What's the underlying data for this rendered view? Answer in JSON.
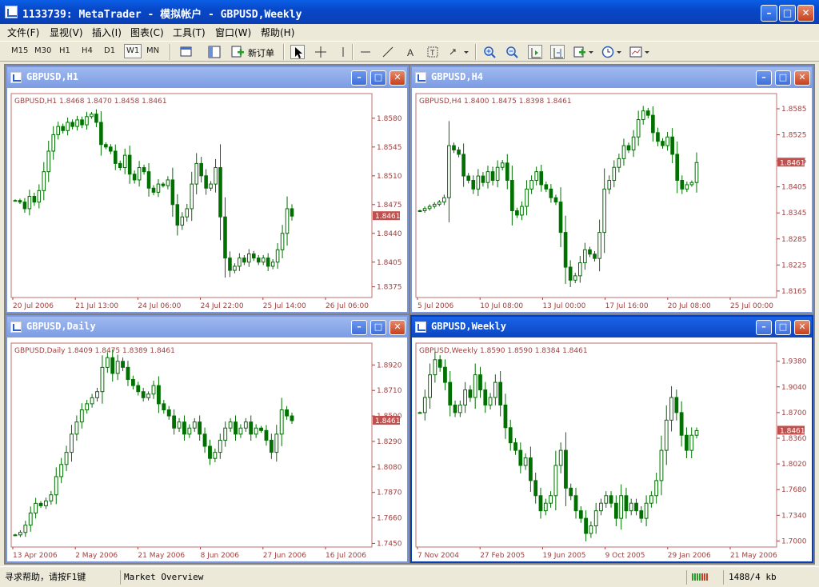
{
  "app": {
    "title": "1133739: MetaTrader - 模拟帐户 - GBPUSD,Weekly"
  },
  "menu": [
    "文件(F)",
    "显视(V)",
    "插入(I)",
    "图表(C)",
    "工具(T)",
    "窗口(W)",
    "帮助(H)"
  ],
  "toolbar": {
    "timeframes": [
      "M15",
      "M30",
      "H1",
      "H4",
      "D1",
      "W1",
      "MN"
    ],
    "active_timeframe": "W1",
    "new_order_label": "新订单"
  },
  "charts": [
    {
      "window_title": "GBPUSD,H1",
      "info": "GBPUSD,H1  1.8468 1.8470 1.8458 1.8461",
      "price_labels": [
        "1.8580",
        "1.8545",
        "1.8510",
        "1.8475",
        "1.8440",
        "1.8405",
        "1.8375"
      ],
      "price_values": [
        1.858,
        1.8545,
        1.851,
        1.8475,
        1.844,
        1.8405,
        1.8375
      ],
      "time_labels": [
        "20 Jul 2006",
        "21 Jul 13:00",
        "24 Jul 06:00",
        "24 Jul 22:00",
        "25 Jul 14:00",
        "26 Jul 06:00"
      ],
      "current_price": "1.8461",
      "ymin": 1.8362,
      "ymax": 1.861,
      "close_path": [
        1.848,
        1.8478,
        1.847,
        1.8485,
        1.8478,
        1.8492,
        1.8515,
        1.854,
        1.856,
        1.857,
        1.8565,
        1.8575,
        1.857,
        1.8578,
        1.8572,
        1.8582,
        1.8585,
        1.8575,
        1.8548,
        1.8545,
        1.854,
        1.8525,
        1.852,
        1.8535,
        1.8512,
        1.8505,
        1.852,
        1.8515,
        1.8495,
        1.849,
        1.85,
        1.8498,
        1.8505,
        1.8475,
        1.845,
        1.846,
        1.847,
        1.85,
        1.8525,
        1.851,
        1.8495,
        1.85,
        1.852,
        1.846,
        1.841,
        1.8395,
        1.84,
        1.841,
        1.8405,
        1.8415,
        1.841,
        1.8405,
        1.841,
        1.84,
        1.8405,
        1.842,
        1.844,
        1.847,
        1.8461
      ]
    },
    {
      "window_title": "GBPUSD,H4",
      "info": "GBPUSD,H4  1.8400 1.8475 1.8398 1.8461",
      "price_labels": [
        "1.8585",
        "1.8525",
        "1.8465",
        "1.8405",
        "1.8345",
        "1.8285",
        "1.8225",
        "1.8165"
      ],
      "price_values": [
        1.8585,
        1.8525,
        1.8465,
        1.8405,
        1.8345,
        1.8285,
        1.8225,
        1.8165
      ],
      "time_labels": [
        "5 Jul 2006",
        "10 Jul 08:00",
        "13 Jul 00:00",
        "17 Jul 16:00",
        "20 Jul 08:00",
        "25 Jul 00:00"
      ],
      "current_price": "1.8461",
      "ymin": 1.815,
      "ymax": 1.862,
      "close_path": [
        1.835,
        1.8355,
        1.836,
        1.8365,
        1.837,
        1.838,
        1.85,
        1.849,
        1.848,
        1.843,
        1.842,
        1.84,
        1.843,
        1.8415,
        1.844,
        1.842,
        1.845,
        1.846,
        1.842,
        1.835,
        1.834,
        1.836,
        1.84,
        1.842,
        1.844,
        1.841,
        1.84,
        1.838,
        1.837,
        1.83,
        1.822,
        1.819,
        1.82,
        1.823,
        1.826,
        1.825,
        1.824,
        1.83,
        1.84,
        1.842,
        1.845,
        1.847,
        1.85,
        1.849,
        1.852,
        1.856,
        1.858,
        1.857,
        1.853,
        1.851,
        1.85,
        1.852,
        1.848,
        1.842,
        1.84,
        1.841,
        1.8415,
        1.8461
      ]
    },
    {
      "window_title": "GBPUSD,Daily",
      "info": "GBPUSD,Daily  1.8409 1.8475 1.8389 1.8461",
      "price_labels": [
        "1.8920",
        "1.8710",
        "1.8500",
        "1.8290",
        "1.8080",
        "1.7870",
        "1.7660",
        "1.7450"
      ],
      "price_values": [
        1.892,
        1.871,
        1.85,
        1.829,
        1.808,
        1.787,
        1.766,
        1.745
      ],
      "time_labels": [
        "13 Apr 2006",
        "2 May 2006",
        "21 May 2006",
        "8 Jun 2006",
        "27 Jun 2006",
        "16 Jul 2006"
      ],
      "current_price": "1.8461",
      "ymin": 1.742,
      "ymax": 1.91,
      "close_path": [
        1.752,
        1.754,
        1.76,
        1.77,
        1.778,
        1.776,
        1.78,
        1.785,
        1.8,
        1.81,
        1.82,
        1.835,
        1.845,
        1.855,
        1.86,
        1.865,
        1.87,
        1.89,
        1.898,
        1.885,
        1.895,
        1.89,
        1.88,
        1.875,
        1.87,
        1.865,
        1.868,
        1.875,
        1.86,
        1.855,
        1.85,
        1.84,
        1.845,
        1.835,
        1.84,
        1.845,
        1.835,
        1.825,
        1.815,
        1.82,
        1.83,
        1.84,
        1.845,
        1.835,
        1.84,
        1.845,
        1.835,
        1.84,
        1.838,
        1.83,
        1.82,
        1.835,
        1.855,
        1.85,
        1.8461
      ]
    },
    {
      "window_title": "GBPUSD,Weekly",
      "info": "GBPUSD,Weekly  1.8590 1.8590 1.8384 1.8461",
      "price_labels": [
        "1.9380",
        "1.9040",
        "1.8700",
        "1.8360",
        "1.8020",
        "1.7680",
        "1.7340",
        "1.7000"
      ],
      "price_values": [
        1.938,
        1.904,
        1.87,
        1.836,
        1.802,
        1.768,
        1.734,
        1.7
      ],
      "time_labels": [
        "7 Nov 2004",
        "27 Feb 2005",
        "19 Jun 2005",
        "9 Oct 2005",
        "29 Jan 2006",
        "21 May 2006"
      ],
      "current_price": "1.8461",
      "ymin": 1.692,
      "ymax": 1.962,
      "close_path": [
        1.87,
        1.89,
        1.92,
        1.94,
        1.93,
        1.91,
        1.88,
        1.87,
        1.88,
        1.9,
        1.89,
        1.92,
        1.9,
        1.88,
        1.89,
        1.91,
        1.88,
        1.85,
        1.83,
        1.82,
        1.8,
        1.81,
        1.78,
        1.76,
        1.74,
        1.75,
        1.76,
        1.8,
        1.82,
        1.77,
        1.76,
        1.74,
        1.73,
        1.71,
        1.72,
        1.74,
        1.75,
        1.76,
        1.75,
        1.73,
        1.76,
        1.74,
        1.75,
        1.74,
        1.73,
        1.75,
        1.76,
        1.78,
        1.82,
        1.86,
        1.89,
        1.87,
        1.84,
        1.82,
        1.84,
        1.8461
      ]
    }
  ],
  "colors": {
    "candle": "#007000",
    "axis_text": "#a04040",
    "price_tag_bg": "#c0504d",
    "grid_border": "#c07070"
  },
  "status": {
    "help": "寻求帮助，请按F1键",
    "profile": "Market Overview",
    "traffic": "1488/4 kb"
  }
}
